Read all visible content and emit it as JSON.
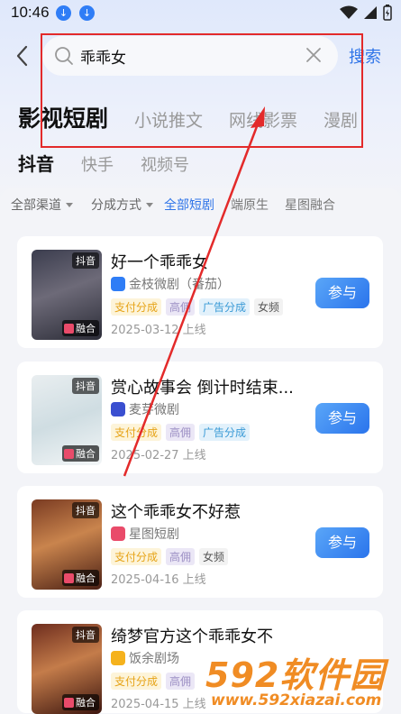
{
  "status": {
    "time": "10:46"
  },
  "search": {
    "value": "乖乖女",
    "button": "搜索"
  },
  "category_tabs": [
    "影视短剧",
    "小说推文",
    "网线影票",
    "漫剧"
  ],
  "platform_tabs": [
    "抖音",
    "快手",
    "视频号"
  ],
  "filters": {
    "dropdowns": [
      "全部渠道",
      "分成方式"
    ],
    "chips": [
      "全部短剧",
      "端原生",
      "星图融合"
    ]
  },
  "cards": [
    {
      "title": "好一个乖乖女",
      "source": "金枝微剧（番茄）",
      "tags": [
        {
          "label": "支付分成",
          "kind": "pay"
        },
        {
          "label": "高佣",
          "kind": "high"
        },
        {
          "label": "广告分成",
          "kind": "ad"
        },
        {
          "label": "女频",
          "kind": "fem"
        }
      ],
      "date": "2025-03-12 上线",
      "badge": "抖音",
      "fuse": "融合",
      "join": "参与",
      "logo_color": "#2f7df6"
    },
    {
      "title": "赏心故事会 倒计时结束...",
      "source": "麦芽微剧",
      "tags": [
        {
          "label": "支付分成",
          "kind": "pay"
        },
        {
          "label": "高佣",
          "kind": "high"
        },
        {
          "label": "广告分成",
          "kind": "ad"
        }
      ],
      "date": "2025-02-27 上线",
      "badge": "抖音",
      "fuse": "融合",
      "join": "参与",
      "logo_color": "#3a4fd0"
    },
    {
      "title": "这个乖乖女不好惹",
      "source": "星图短剧",
      "tags": [
        {
          "label": "支付分成",
          "kind": "pay"
        },
        {
          "label": "高佣",
          "kind": "high"
        },
        {
          "label": "女频",
          "kind": "fem"
        }
      ],
      "date": "2025-04-16 上线",
      "badge": "抖音",
      "fuse": "融合",
      "join": "参与",
      "logo_color": "#e94b6a"
    },
    {
      "title": "绮梦官方这个乖乖女不",
      "source": "饭余剧场",
      "tags": [
        {
          "label": "支付分成",
          "kind": "pay"
        },
        {
          "label": "高佣",
          "kind": "high"
        }
      ],
      "date": "2025-04-15 上线",
      "badge": "抖音",
      "fuse": "融合",
      "join": "参与",
      "logo_color": "#f5b21d"
    }
  ],
  "watermark": {
    "brand": "592软件园",
    "url": "www.592xiazai.com"
  },
  "colors": {
    "accent": "#2f74e8",
    "annotation": "#e32a2a",
    "watermark": "#f08c24"
  }
}
